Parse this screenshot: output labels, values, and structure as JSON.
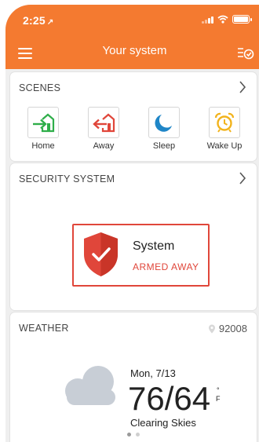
{
  "status_bar": {
    "time": "2:25",
    "location_arrow": "↗"
  },
  "header": {
    "title": "Your system",
    "menu_icon": "hamburger-menu-icon",
    "right_icon": "list-check-icon"
  },
  "scenes": {
    "title": "SCENES",
    "items": [
      {
        "label": "Home",
        "icon": "home-enter-icon",
        "color": "#2fae4a"
      },
      {
        "label": "Away",
        "icon": "home-exit-icon",
        "color": "#e0463a"
      },
      {
        "label": "Sleep",
        "icon": "moon-icon",
        "color": "#1f86c7"
      },
      {
        "label": "Wake Up",
        "icon": "alarm-clock-icon",
        "color": "#f2b31c"
      }
    ]
  },
  "security": {
    "title": "SECURITY SYSTEM",
    "system_label": "System",
    "status": "ARMED AWAY",
    "accent": "#e0463a"
  },
  "weather": {
    "title": "WEATHER",
    "zip": "92008",
    "date": "Mon, 7/13",
    "temp": "76/64",
    "unit_deg": "°",
    "unit_f": "F",
    "description": "Clearing Skies"
  },
  "colors": {
    "brand": "#f47a30"
  }
}
